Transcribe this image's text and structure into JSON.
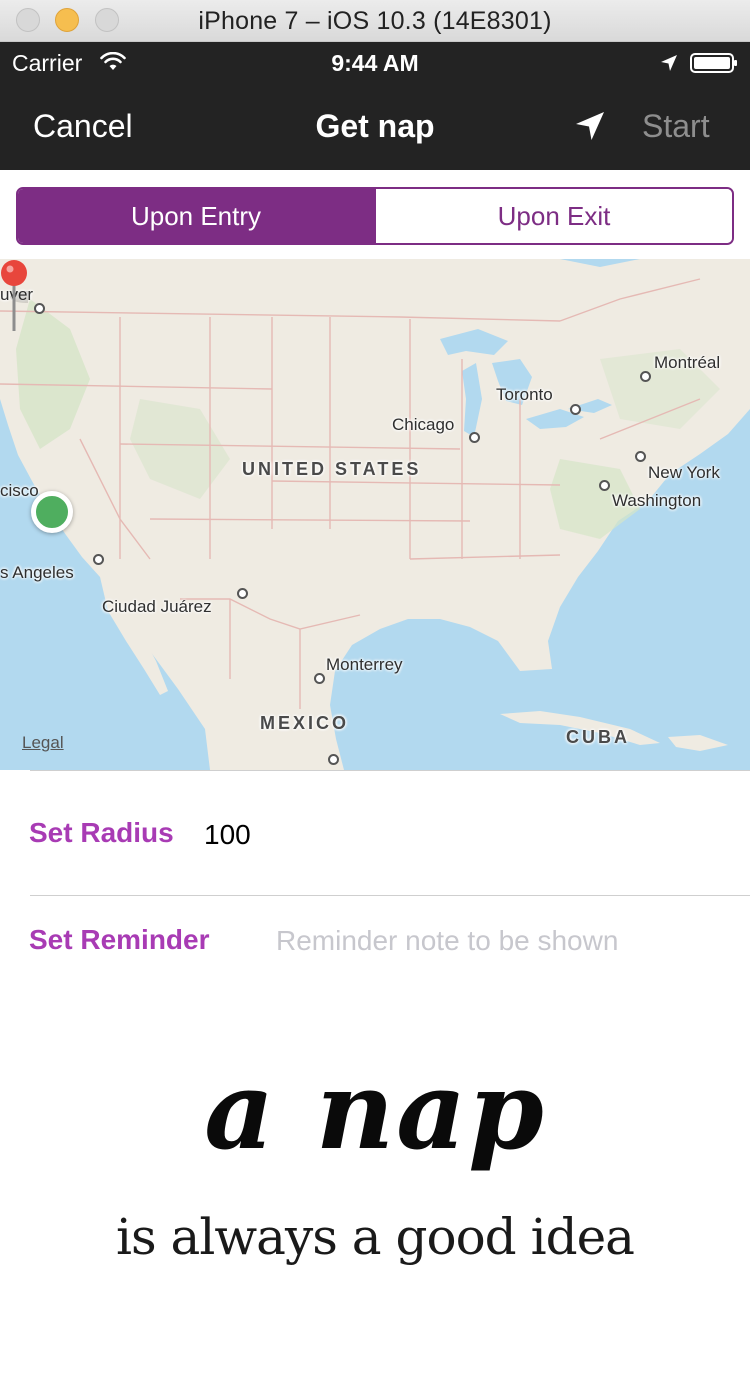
{
  "simulator": {
    "title": "iPhone 7 – iOS 10.3 (14E8301)"
  },
  "status_bar": {
    "carrier": "Carrier",
    "time": "9:44 AM",
    "icons": [
      "wifi-icon",
      "location-arrow-icon",
      "battery-icon"
    ]
  },
  "nav": {
    "cancel_label": "Cancel",
    "title": "Get nap",
    "locate_icon": "location-arrow-icon",
    "start_label": "Start"
  },
  "segments": {
    "items": [
      {
        "label": "Upon Entry",
        "selected": true
      },
      {
        "label": "Upon Exit",
        "selected": false
      }
    ],
    "accent_color": "#7d2d84"
  },
  "map": {
    "labels": {
      "vancouver": "uver",
      "montreal": "Montréal",
      "toronto": "Toronto",
      "chicago": "Chicago",
      "united_states": "UNITED STATES",
      "new_york": "New York",
      "washington": "Washington",
      "san_francisco": "cisco",
      "los_angeles": "s Angeles",
      "ciudad_juarez": "Ciudad Juárez",
      "monterrey": "Monterrey",
      "mexico": "MEXICO",
      "cuba": "CUBA"
    },
    "legal_label": "Legal",
    "user_location_color": "#4fae5f",
    "pin_color": "#e8463c"
  },
  "form": {
    "radius_label": "Set Radius",
    "radius_value": "100",
    "reminder_label": "Set Reminder",
    "reminder_placeholder": "Reminder note to be shown",
    "label_color": "#a83bb4"
  },
  "illustration": {
    "line1": "a nap",
    "line2": "is always a good idea"
  }
}
